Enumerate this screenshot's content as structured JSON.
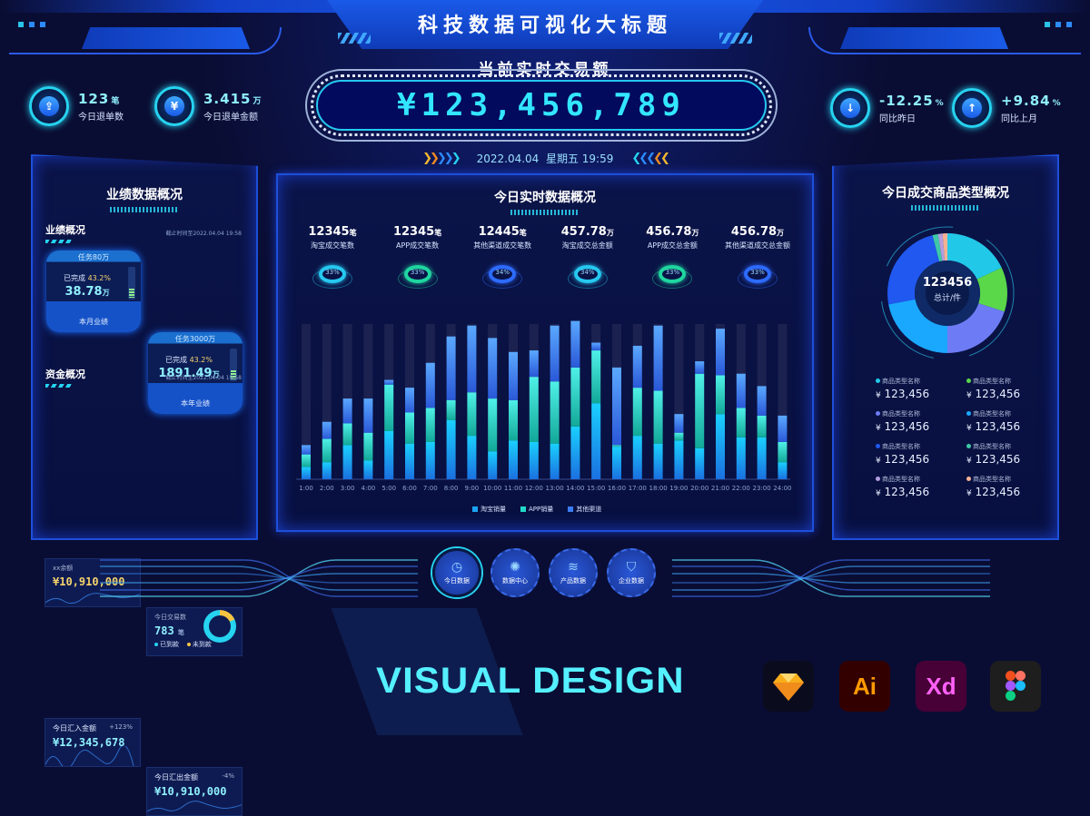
{
  "header": {
    "title": "科技数据可视化大标题",
    "total_label": "当前实时交易额",
    "total_value": "¥123,456,789",
    "date": "2022.04.04",
    "weekday_time": "星期五 19:59"
  },
  "kpis_left": [
    {
      "icon": "refund-box-icon",
      "value": "123",
      "unit": "笔",
      "label": "今日退单数"
    },
    {
      "icon": "yen-icon",
      "value": "3.415",
      "unit": "万",
      "label": "今日退单金额"
    }
  ],
  "kpis_right": [
    {
      "icon": "arrow-down-icon",
      "value": "-12.25",
      "unit": "%",
      "label": "同比昨日"
    },
    {
      "icon": "arrow-up-icon",
      "value": "+9.84",
      "unit": "%",
      "label": "同比上月"
    }
  ],
  "left_panel": {
    "title": "业绩数据概况",
    "performance": {
      "heading": "业绩概况",
      "timestamp": "截止时间至2022.04.04 19:58",
      "cards": [
        {
          "task": "任务80万",
          "done_label": "已完成",
          "done_pct": "43.2%",
          "amount": "38.78",
          "unit": "万",
          "label": "本月业绩"
        },
        {
          "task": "任务3000万",
          "done_label": "已完成",
          "done_pct": "43.2%",
          "amount": "1891.49",
          "unit": "万",
          "label": "本年业绩"
        }
      ]
    },
    "funds": {
      "heading": "资金概况",
      "timestamp": "截止时间至2022.04.04 19:58",
      "balance": {
        "label": "xx余额",
        "value": "¥10,910,000"
      },
      "transactions": {
        "label": "今日交易数",
        "value": "783",
        "unit": "笔",
        "legend_received": "已到款",
        "legend_pending": "未到款",
        "pending_fraction": 0.18
      },
      "inflow": {
        "label": "今日汇入金额",
        "change": "+123%",
        "value": "¥12,345,678"
      },
      "outflow": {
        "label": "今日汇出金额",
        "change": "-4%",
        "value": "¥10,910,000"
      }
    }
  },
  "mid_panel": {
    "title": "今日实时数据概况",
    "stats": [
      {
        "value": "12345",
        "unit": "笔",
        "label": "淘宝成交笔数",
        "pct": "33%",
        "color": "#26c8f0"
      },
      {
        "value": "12345",
        "unit": "笔",
        "label": "APP成交笔数",
        "pct": "33%",
        "color": "#1fd6a0"
      },
      {
        "value": "12445",
        "unit": "笔",
        "label": "其他渠道成交笔数",
        "pct": "34%",
        "color": "#2d6bff"
      },
      {
        "value": "457.78",
        "unit": "万",
        "label": "淘宝成交总金额",
        "pct": "34%",
        "color": "#26c8f0"
      },
      {
        "value": "456.78",
        "unit": "万",
        "label": "APP成交总金额",
        "pct": "33%",
        "color": "#1fd6a0"
      },
      {
        "value": "456.78",
        "unit": "万",
        "label": "其他渠道成交总金额",
        "pct": "33%",
        "color": "#2d6bff"
      }
    ]
  },
  "chart_data": {
    "type": "bar",
    "stacked": true,
    "title": "",
    "xlabel": "",
    "ylabel": "",
    "ylim": [
      0,
      100
    ],
    "grid": false,
    "legend_position": "bottom",
    "categories": [
      "1:00",
      "2:00",
      "3:00",
      "4:00",
      "5:00",
      "6:00",
      "7:00",
      "8:00",
      "9:00",
      "10:00",
      "11:00",
      "12:00",
      "13:00",
      "14:00",
      "15:00",
      "16:00",
      "17:00",
      "18:00",
      "19:00",
      "20:00",
      "21:00",
      "22:00",
      "23:00",
      "24:00"
    ],
    "series": [
      {
        "name": "淘宝销量",
        "color": "#1aa3f0",
        "values": [
          8,
          11,
          22,
          12,
          31,
          23,
          24,
          38,
          28,
          18,
          25,
          24,
          23,
          34,
          49,
          21,
          28,
          23,
          25,
          20,
          42,
          27,
          27,
          11
        ]
      },
      {
        "name": "APP销量",
        "color": "#22d8c8",
        "values": [
          8,
          15,
          14,
          18,
          30,
          20,
          22,
          13,
          28,
          34,
          26,
          42,
          40,
          38,
          34,
          1,
          31,
          34,
          5,
          48,
          25,
          19,
          14,
          13
        ]
      },
      {
        "name": "其他渠道",
        "color": "#3a7cf0",
        "values": [
          6,
          11,
          16,
          22,
          3,
          16,
          29,
          41,
          43,
          39,
          31,
          17,
          36,
          30,
          5,
          50,
          27,
          42,
          12,
          8,
          30,
          22,
          19,
          17
        ]
      }
    ]
  },
  "right_panel": {
    "title": "今日成交商品类型概况",
    "total_value": "123456",
    "total_label": "总计/件",
    "pie": [
      {
        "name": "商品类型名称",
        "value": 18,
        "color": "#22c8e8"
      },
      {
        "name": "商品类型名称",
        "value": 12,
        "color": "#5ad84a"
      },
      {
        "name": "商品类型名称",
        "value": 20,
        "color": "#6d7cf5"
      },
      {
        "name": "商品类型名称",
        "value": 22,
        "color": "#1aa8ff"
      },
      {
        "name": "商品类型名称",
        "value": 24,
        "color": "#2058f0"
      },
      {
        "name": "商品类型名称",
        "value": 1.5,
        "color": "#3ec8a8"
      },
      {
        "name": "商品类型名称",
        "value": 1.2,
        "color": "#b39ddf"
      },
      {
        "name": "商品类型名称",
        "value": 1.3,
        "color": "#f5b394"
      }
    ],
    "categories": [
      {
        "name": "商品类型名称",
        "value": "123,456",
        "color": "#22c8e8"
      },
      {
        "name": "商品类型名称",
        "value": "123,456",
        "color": "#5ad84a"
      },
      {
        "name": "商品类型名称",
        "value": "123,456",
        "color": "#6d7cf5"
      },
      {
        "name": "商品类型名称",
        "value": "123,456",
        "color": "#1aa8ff"
      },
      {
        "name": "商品类型名称",
        "value": "123,456",
        "color": "#2058f0"
      },
      {
        "name": "商品类型名称",
        "value": "123,456",
        "color": "#3ec8a8"
      },
      {
        "name": "商品类型名称",
        "value": "123,456",
        "color": "#b39ddf"
      },
      {
        "name": "商品类型名称",
        "value": "123,456",
        "color": "#f5b394"
      }
    ],
    "currency": "¥"
  },
  "nav": [
    {
      "label": "今日数据",
      "icon": "clock-icon",
      "active": true
    },
    {
      "label": "数据中心",
      "icon": "network-icon",
      "active": false
    },
    {
      "label": "产品数据",
      "icon": "layers-icon",
      "active": false
    },
    {
      "label": "企业数据",
      "icon": "enterprise-shield-icon",
      "active": false
    }
  ],
  "footer": {
    "brand": "VISUAL DESIGN",
    "apps": [
      {
        "name": "sketch-icon",
        "label": ""
      },
      {
        "name": "illustrator-icon",
        "label": "Ai"
      },
      {
        "name": "xd-icon",
        "label": "Xd"
      },
      {
        "name": "figma-icon",
        "label": ""
      }
    ]
  }
}
